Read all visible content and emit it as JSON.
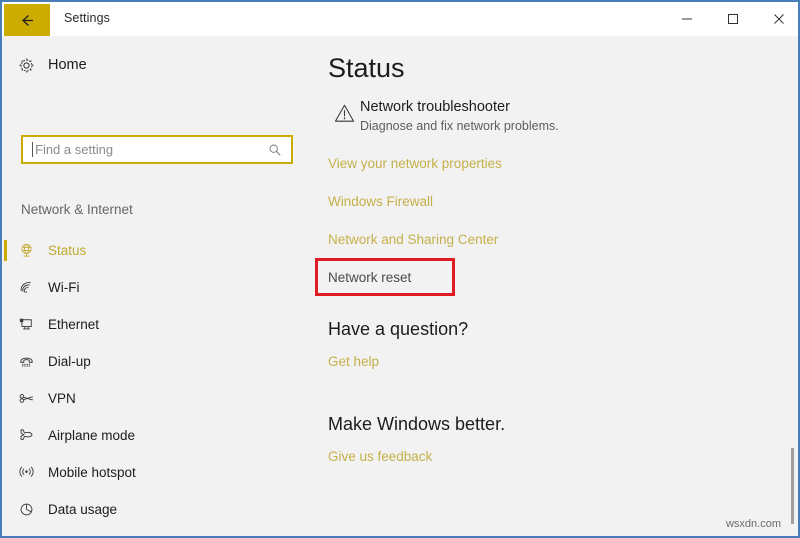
{
  "window": {
    "title": "Settings",
    "back_icon": "back-arrow-icon",
    "controls": {
      "minimize": "minimize-icon",
      "maximize": "maximize-icon",
      "close": "close-icon"
    }
  },
  "sidebar": {
    "home": {
      "label": "Home",
      "icon": "gear-icon"
    },
    "search": {
      "placeholder": "Find a setting",
      "value": "",
      "icon": "search-icon"
    },
    "section_header": "Network & Internet",
    "items": [
      {
        "label": "Status",
        "icon": "globe-network-icon",
        "selected": true
      },
      {
        "label": "Wi-Fi",
        "icon": "wifi-icon",
        "selected": false
      },
      {
        "label": "Ethernet",
        "icon": "ethernet-icon",
        "selected": false
      },
      {
        "label": "Dial-up",
        "icon": "dialup-phone-icon",
        "selected": false
      },
      {
        "label": "VPN",
        "icon": "vpn-key-icon",
        "selected": false
      },
      {
        "label": "Airplane mode",
        "icon": "airplane-icon",
        "selected": false
      },
      {
        "label": "Mobile hotspot",
        "icon": "hotspot-icon",
        "selected": false
      },
      {
        "label": "Data usage",
        "icon": "pie-chart-icon",
        "selected": false
      }
    ]
  },
  "main": {
    "title": "Status",
    "troubleshooter": {
      "icon": "warning-triangle-icon",
      "title": "Network troubleshooter",
      "description": "Diagnose and fix network problems."
    },
    "links": [
      "View your network properties",
      "Windows Firewall",
      "Network and Sharing Center"
    ],
    "network_reset": "Network reset",
    "question_heading": "Have a question?",
    "get_help": "Get help",
    "feedback_heading": "Make Windows better.",
    "give_feedback": "Give us feedback"
  },
  "annotation": {
    "highlight_target": "Network reset",
    "color": "#e01b24"
  },
  "watermark": "wsxdn.com",
  "colors": {
    "accent_yellow": "#ccac00",
    "link_yellow": "#c5b04a",
    "window_border": "#4a7ebb",
    "background": "#f2f2f2",
    "annotation_red": "#e01b24"
  }
}
